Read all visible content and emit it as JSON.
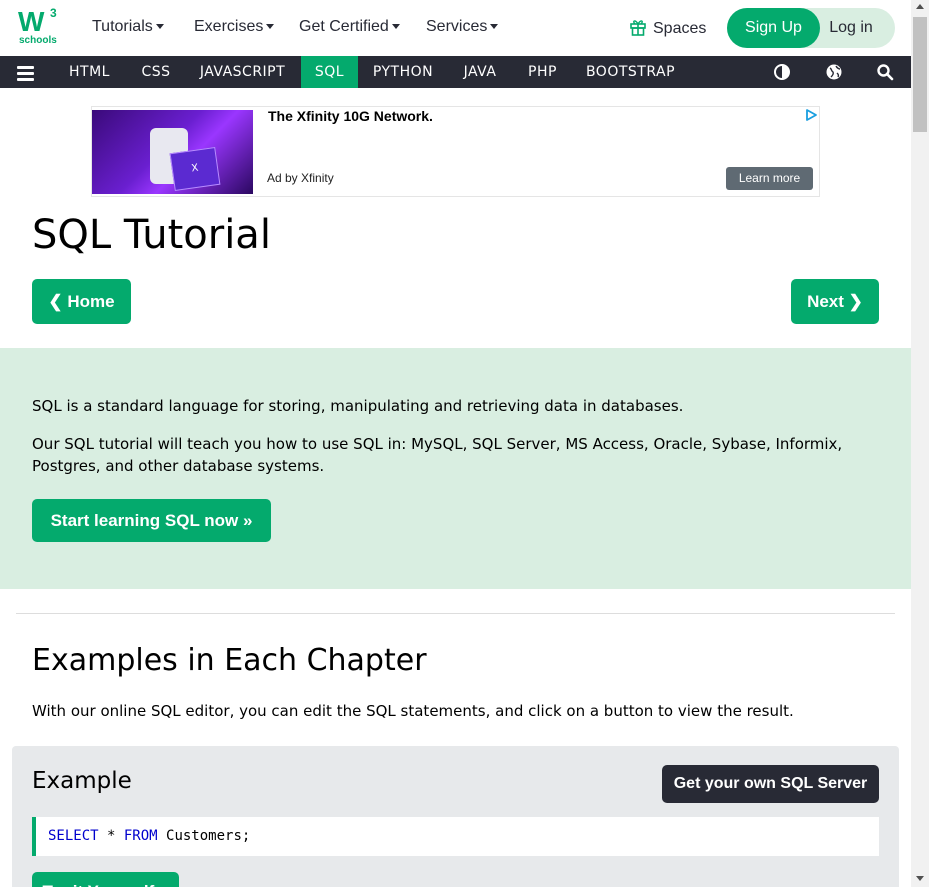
{
  "logo": {
    "main": "W",
    "sup": "3",
    "sub": "schools"
  },
  "topnav": {
    "items": [
      {
        "label": "Tutorials"
      },
      {
        "label": "Exercises"
      },
      {
        "label": "Get Certified"
      },
      {
        "label": "Services"
      }
    ],
    "spaces": "Spaces",
    "signup": "Sign Up",
    "login": "Log in"
  },
  "darknav": {
    "items": [
      "HTML",
      "CSS",
      "JAVASCRIPT",
      "SQL",
      "PYTHON",
      "JAVA",
      "PHP",
      "BOOTSTRAP"
    ],
    "active": "SQL",
    "icons": [
      "menu-icon",
      "contrast-icon",
      "globe-icon",
      "search-icon"
    ]
  },
  "ad": {
    "title": "The Xfinity 10G Network.",
    "by": "Ad by Xfinity",
    "cta": "Learn more",
    "image_text": "X"
  },
  "page": {
    "title": "SQL Tutorial",
    "home_label": "❮ Home",
    "next_label": "Next ❯"
  },
  "intro": {
    "p1": "SQL is a standard language for storing, manipulating and retrieving data in databases.",
    "p2": "Our SQL tutorial will teach you how to use SQL in: MySQL, SQL Server, MS Access, Oracle, Sybase, Informix, Postgres, and other database systems.",
    "start_label": "Start learning SQL now »"
  },
  "examples": {
    "heading": "Examples in Each Chapter",
    "desc": "With our online SQL editor, you can edit the SQL statements, and click on a button to view the result.",
    "box_title": "Example",
    "own_server": "Get your own SQL Server",
    "code": {
      "kw1": "SELECT",
      "star": " * ",
      "kw2": "FROM",
      "rest": " Customers;"
    },
    "tryit": "Try it Yourself »"
  },
  "colors": {
    "brand": "#04AA6D",
    "dark": "#282A35",
    "intro_bg": "#D9EEE1",
    "example_bg": "#E7E9EB",
    "keyword": "#0000CD"
  }
}
